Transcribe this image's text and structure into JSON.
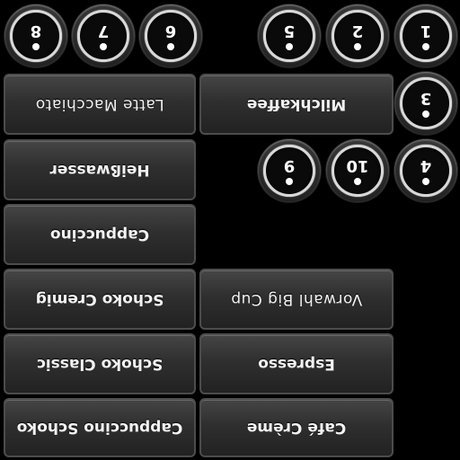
{
  "keys": [
    {
      "label": "8"
    },
    {
      "label": "7"
    },
    {
      "label": "6"
    },
    {
      "label": "5"
    },
    {
      "label": "2"
    },
    {
      "label": "1"
    },
    {
      "label": "3"
    },
    {
      "label": "9"
    },
    {
      "label": "10"
    },
    {
      "label": "4"
    }
  ],
  "buttons": {
    "latte_macchiato": "Latte Macchiato",
    "milchkaffee": "Milchkaffee",
    "heisswasser": "Heißwasser",
    "cappuccino": "Cappuccino",
    "schoko_cremig": "Schoko Cremig",
    "vorwahl_big_cup": "Vorwahl Big Cup",
    "schoko_classic": "Schoko Classic",
    "espresso": "Espresso",
    "cappuccino_schoko": "Cappuccino Schoko",
    "cafe_creme": "Café Crème"
  }
}
